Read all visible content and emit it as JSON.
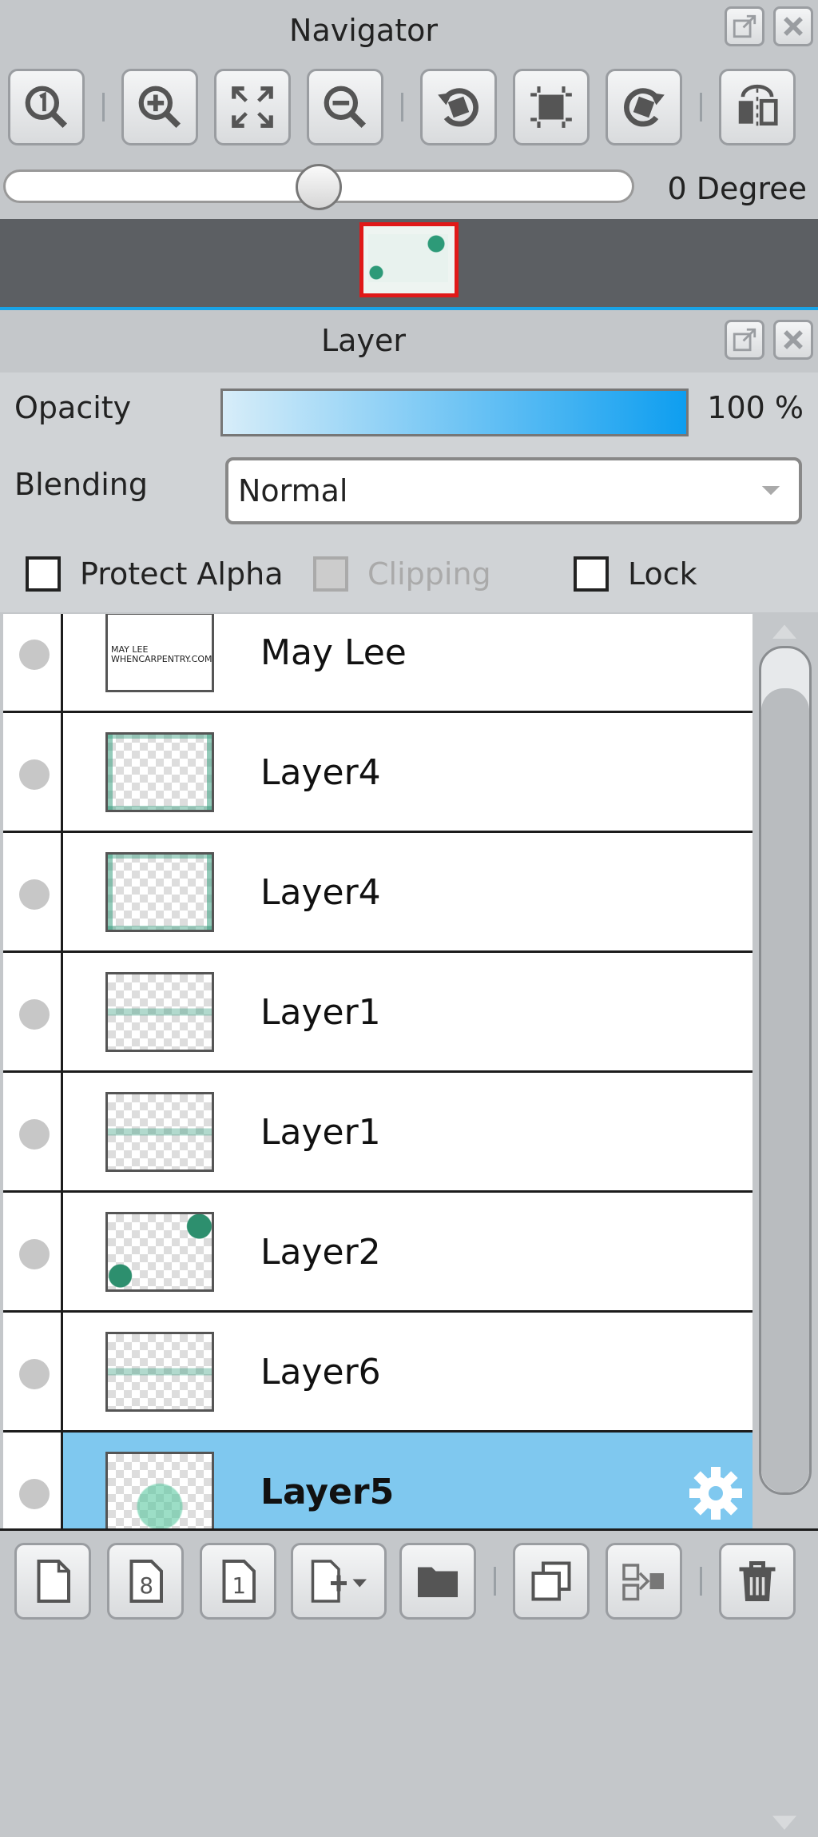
{
  "navigator": {
    "title": "Navigator",
    "rotation_label": "0 Degree",
    "rotation_slider_position": 0.5,
    "toolbar_icons": [
      "zoom-actual-icon",
      "zoom-in-icon",
      "fit-window-icon",
      "zoom-out-icon",
      "rotate-left-icon",
      "reset-view-icon",
      "rotate-right-icon",
      "flip-horizontal-icon"
    ]
  },
  "layer_panel": {
    "title": "Layer",
    "opacity_label": "Opacity",
    "opacity_value": "100 %",
    "opacity_fraction": 1.0,
    "blending_label": "Blending",
    "blending_value": "Normal",
    "protect_alpha_label": "Protect Alpha",
    "clipping_label": "Clipping",
    "lock_label": "Lock",
    "layers": [
      {
        "name": "May Lee",
        "thumb_text": "MAY LEE\nWHENCARPENTRY.COM"
      },
      {
        "name": "Layer4"
      },
      {
        "name": "Layer4"
      },
      {
        "name": "Layer1"
      },
      {
        "name": "Layer1"
      },
      {
        "name": "Layer2"
      },
      {
        "name": "Layer6"
      },
      {
        "name": "Layer5",
        "selected": true
      }
    ],
    "bottom_icons": [
      "new-layer-icon",
      "new-8bit-layer-icon",
      "new-1bit-layer-icon",
      "add-layer-menu-icon",
      "new-folder-icon",
      "duplicate-layer-icon",
      "merge-down-icon",
      "delete-layer-icon"
    ],
    "bottom_text": {
      "8bit": "8",
      "1bit": "1"
    }
  },
  "colors": {
    "accent_blue": "#0e9ef0",
    "selected_row": "#7fc8ef",
    "preview_border": "#e01818",
    "panel_bg": "#c4c7ca"
  }
}
